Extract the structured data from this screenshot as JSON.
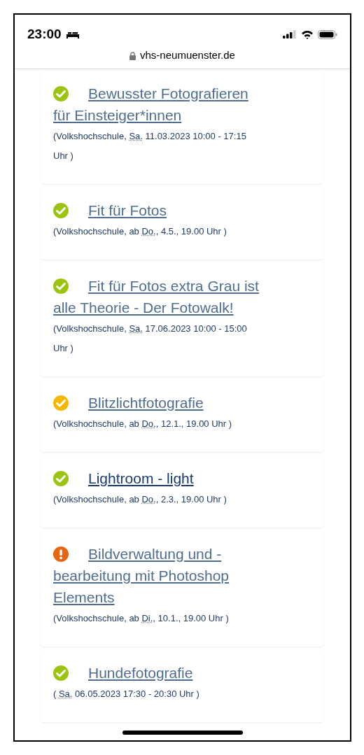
{
  "status_bar": {
    "time": "23:00"
  },
  "address_bar": {
    "url": "vhs-neumuenster.de"
  },
  "courses": [
    {
      "kind": "available",
      "title": "Bewusster Fotografieren für Einsteiger*innen",
      "visited": false,
      "details": {
        "before": "(Volkshochschule, ",
        "abbr": "Sa.",
        "after": " 11.03.2023 10:00 - 17:15 Uhr )"
      }
    },
    {
      "kind": "available",
      "title": "Fit für Fotos",
      "visited": false,
      "details": {
        "before": "(Volkshochschule, ab ",
        "abbr": "Do.",
        "after": ", 4.5., 19.00 Uhr )"
      }
    },
    {
      "kind": "available",
      "title": "Fit für Fotos extra Grau ist alle Theorie - Der Fotowalk!",
      "visited": false,
      "details": {
        "before": "(Volkshochschule, ",
        "abbr": "Sa.",
        "after": " 17.06.2023 10:00 - 15:00 Uhr )"
      }
    },
    {
      "kind": "few",
      "title": "Blitzlichtfotografie",
      "visited": false,
      "details": {
        "before": "(Volkshochschule, ab ",
        "abbr": "Do.",
        "after": ", 12.1., 19.00 Uhr )"
      }
    },
    {
      "kind": "available",
      "title": "Lightroom - light",
      "visited": true,
      "details": {
        "before": "(Volkshochschule, ab ",
        "abbr": "Do.",
        "after": ", 2.3., 19.00 Uhr )"
      }
    },
    {
      "kind": "full",
      "title": "Bildverwaltung und -bearbeitung mit Photoshop Elements",
      "visited": false,
      "details": {
        "before": "(Volkshochschule, ab ",
        "abbr": "Di.",
        "after": ", 10.1., 19.00 Uhr )"
      }
    },
    {
      "kind": "available",
      "title": "Hundefotografie",
      "visited": false,
      "details": {
        "before": "( ",
        "abbr": "Sa.",
        "after": " 06.05.2023 17:30 - 20:30 Uhr )"
      }
    }
  ]
}
